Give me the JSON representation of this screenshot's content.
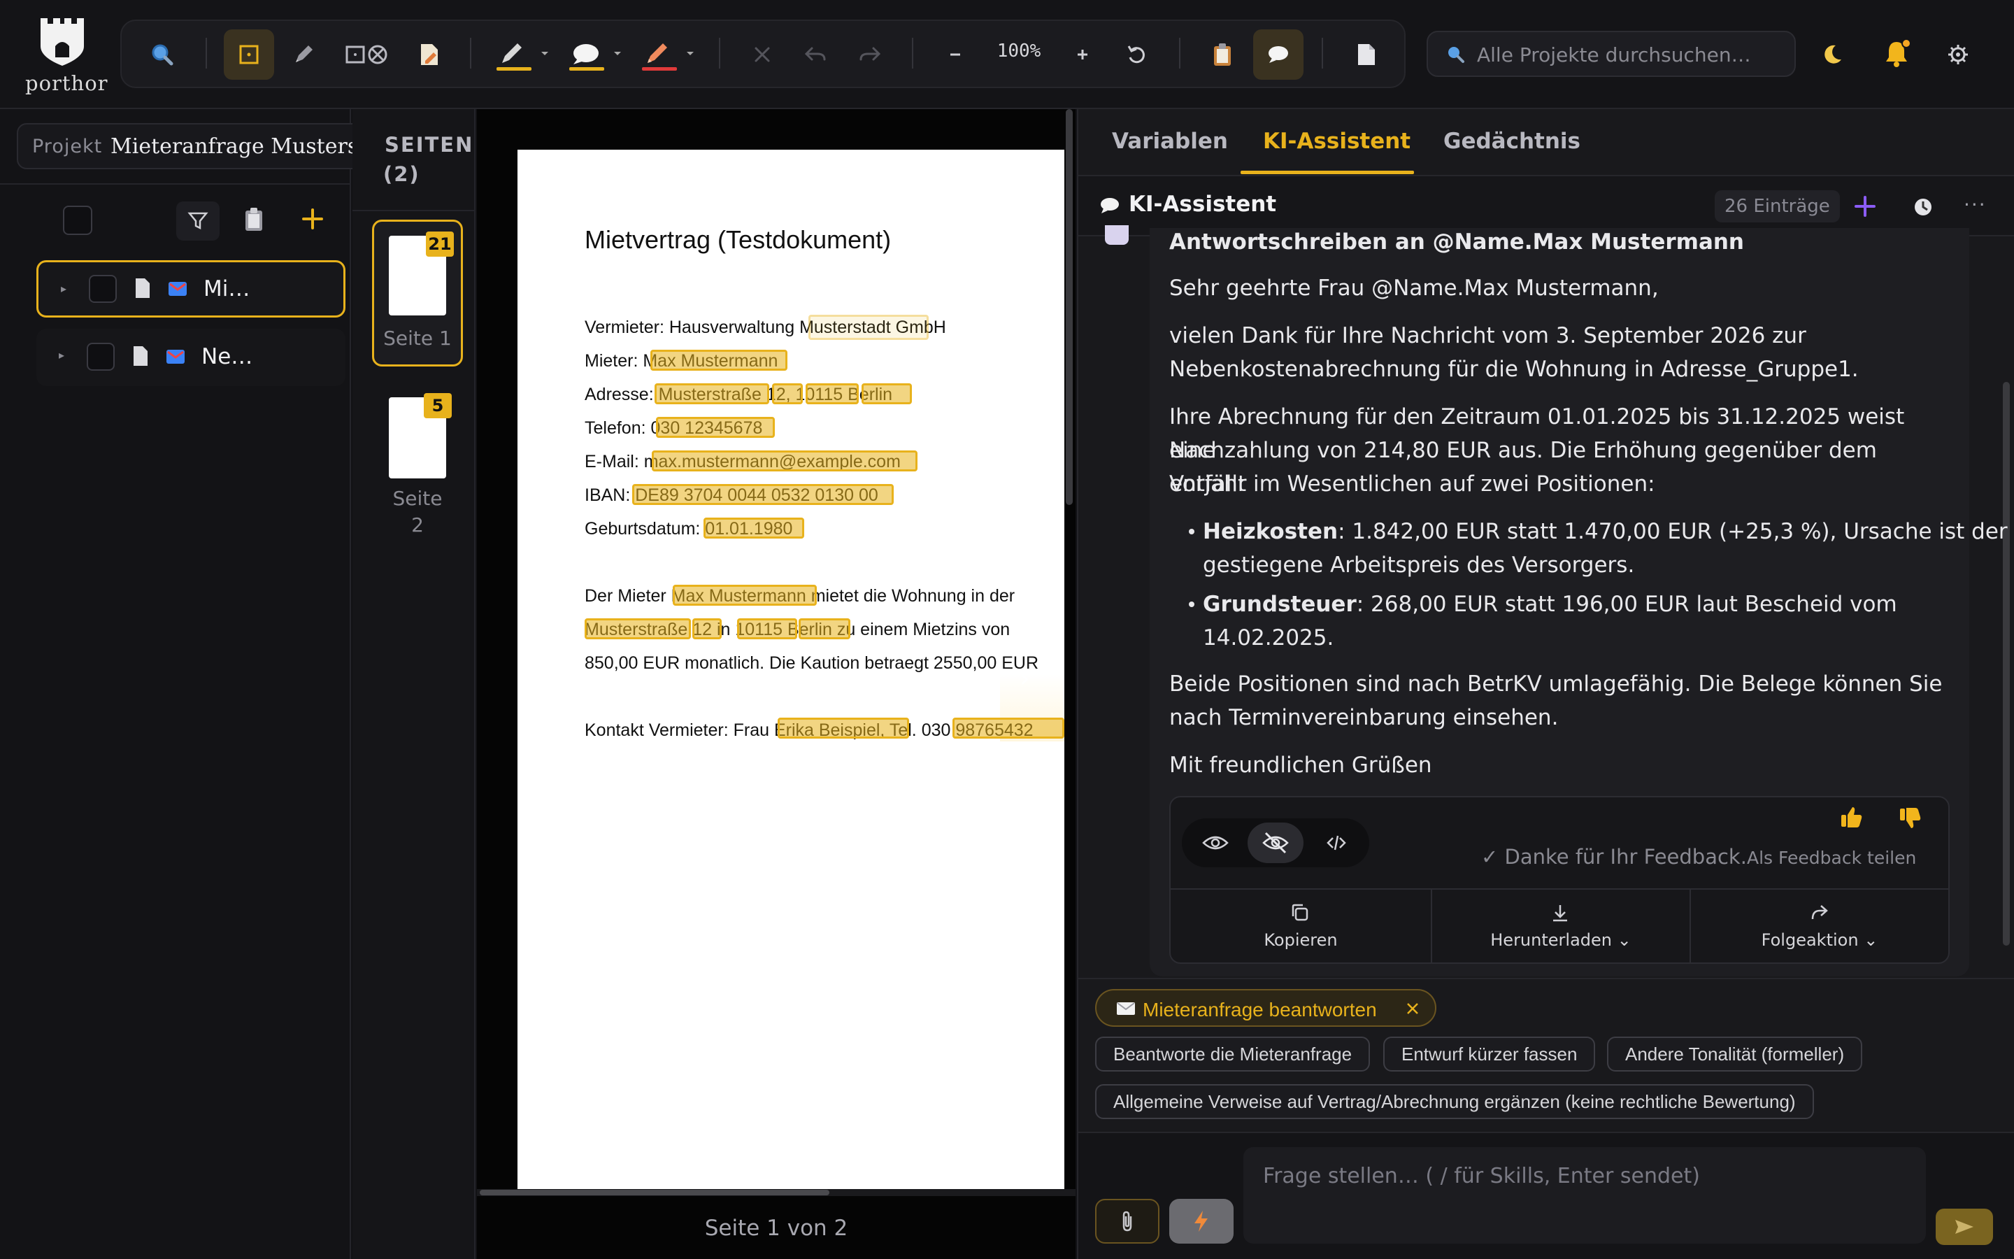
{
  "app": {
    "logo_text": "porthor"
  },
  "toolbar": {
    "zoom_label": "100%",
    "search_placeholder": "Alle Projekte durchsuchen…"
  },
  "project": {
    "label": "Projekt",
    "name": "Mieteranfrage Musterstrass"
  },
  "tree": {
    "items": [
      {
        "label": "Mi…"
      },
      {
        "label": "Ne…"
      }
    ]
  },
  "pages": {
    "header": "SEITEN",
    "count": "(2)",
    "items": [
      {
        "label": "Seite 1",
        "badge": "21"
      },
      {
        "label": "Seite",
        "label2": "2",
        "badge": "5"
      }
    ]
  },
  "document": {
    "title": "Mietvertrag (Testdokument)",
    "lines": [
      "Vermieter: Hausverwaltung Musterstadt GmbH",
      "Mieter: Max Mustermann",
      "Adresse: Musterstraße 12, 10115 Berlin",
      "Telefon: 030 12345678",
      "E-Mail: max.mustermann@example.com",
      "IBAN: DE89 3704 0044 0532 0130 00",
      "Geburtsdatum: 01.01.1980",
      "Der Mieter Max Mustermann mietet die Wohnung in der",
      "Musterstraße 12 in 10115 Berlin zu einem Mietzins von",
      "850,00 EUR monatlich. Die Kaution betraegt 2550,00 EUR",
      "Kontakt Vermieter: Frau Erika Beispiel, Tel. 030 98765432"
    ],
    "footer": "Seite 1 von 2"
  },
  "right_panel": {
    "tabs": [
      {
        "label": "Variablen"
      },
      {
        "label": "KI-Assistent"
      },
      {
        "label": "Gedächtnis"
      }
    ],
    "header_title": "KI-Assistent",
    "entries_badge": "26 Einträge",
    "message": {
      "heading": "Antwortschreiben an @Name.Max Mustermann",
      "greeting": "Sehr geehrte Frau @Name.Max Mustermann,",
      "p1_l1": "vielen Dank für Ihre Nachricht vom 3. September 2026 zur",
      "p1_l2": "Nebenkostenabrechnung für die Wohnung in Adresse_Gruppe1.",
      "p2_l1": "Ihre Abrechnung für den Zeitraum 01.01.2025 bis 31.12.2025 weist eine",
      "p2_l2": "Nachzahlung von 214,80 EUR aus. Die Erhöhung gegenüber dem Vorjahr",
      "p2_l3": "entfällt im Wesentlichen auf zwei Positionen:",
      "b1_bold": "Heizkosten",
      "b1_l1": ": 1.842,00 EUR statt 1.470,00 EUR (+25,3 %), Ursache ist der",
      "b1_l2": "gestiegene Arbeitspreis des Versorgers.",
      "b2_bold": "Grundsteuer",
      "b2_l1": ": 268,00 EUR statt 196,00 EUR laut Bescheid vom",
      "b2_l2": "14.02.2025.",
      "p3_l1": "Beide Positionen sind nach BetrKV umlagefähig. Die Belege können Sie",
      "p3_l2": "nach Terminvereinbarung einsehen.",
      "closing": "Mit freundlichen Grüßen"
    },
    "feedback_thanks": "✓ Danke für Ihr Feedback.",
    "feedback_share": "Als Feedback teilen",
    "actions": {
      "copy": "Kopieren",
      "download": "Herunterladen",
      "followup": "Folgeaktion"
    },
    "skill_chip": "Mieteranfrage beantworten",
    "suggestions": [
      "Beantworte die Mieteranfrage",
      "Entwurf kürzer fassen",
      "Andere Tonalität (formeller)",
      "Allgemeine Verweise auf Vertrag/Abrechnung ergänzen (keine rechtliche Bewertung)"
    ],
    "input_placeholder": "Frage stellen… ( / für Skills, Enter sendet)"
  },
  "colors": {
    "accent": "#e8b21c",
    "bg": "#121215",
    "panel": "#1a1a1e",
    "purple": "#8b5cf6"
  }
}
